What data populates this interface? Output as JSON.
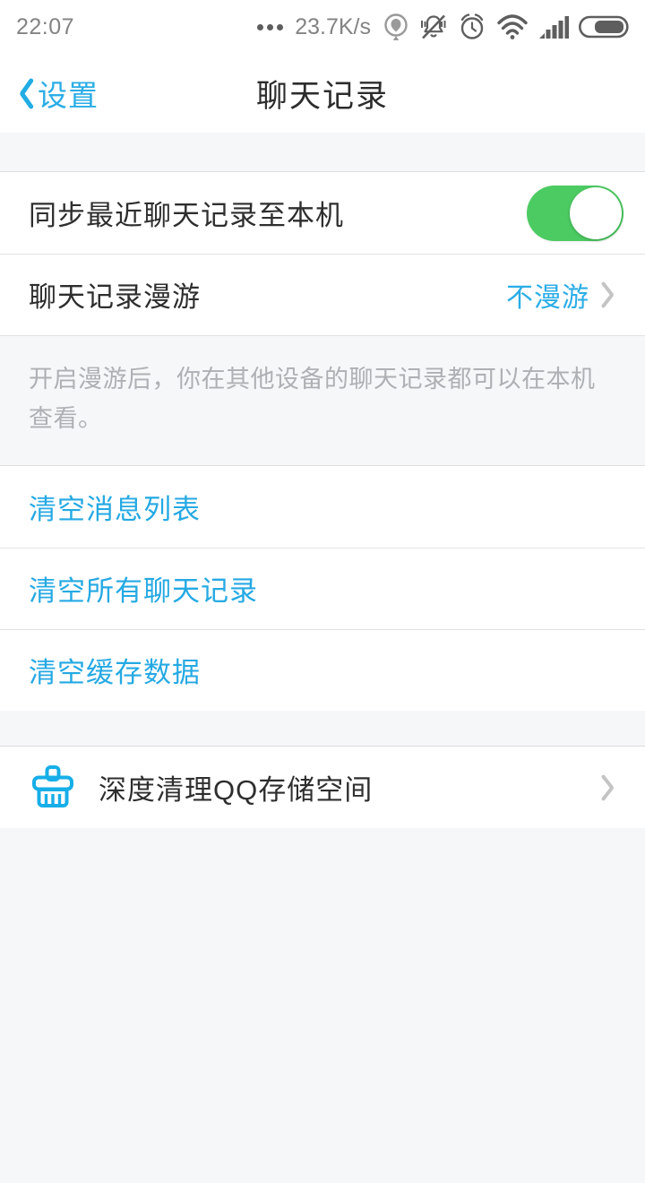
{
  "statusbar": {
    "time": "22:07",
    "network_speed": "23.7K/s",
    "icons": [
      "notification-dots-icon",
      "location-icon",
      "mute-bell-icon",
      "alarm-clock-icon",
      "wifi-icon",
      "signal-bars-icon",
      "battery-icon"
    ]
  },
  "navbar": {
    "back_label": "设置",
    "title": "聊天记录"
  },
  "sync_row": {
    "label": "同步最近聊天记录至本机",
    "toggle_state": "on"
  },
  "roaming_row": {
    "label": "聊天记录漫游",
    "value": "不漫游"
  },
  "help": {
    "text": "开启漫游后，你在其他设备的聊天记录都可以在本机查看。"
  },
  "actions": [
    {
      "label": "清空消息列表"
    },
    {
      "label": "清空所有聊天记录"
    },
    {
      "label": "清空缓存数据"
    }
  ],
  "deep_clean_row": {
    "label": "深度清理QQ存储空间",
    "icon": "broom-icon"
  },
  "colors": {
    "accent_blue": "#25a9e3",
    "toggle_green": "#4ccb62",
    "page_bg": "#f6f7f9",
    "card_bg": "#ffffff",
    "divider": "#e2e2e2",
    "help_text": "#adb0b4",
    "status_text": "#838383",
    "title_text": "#2c2c2c",
    "chevron": "#c4c4c4"
  }
}
